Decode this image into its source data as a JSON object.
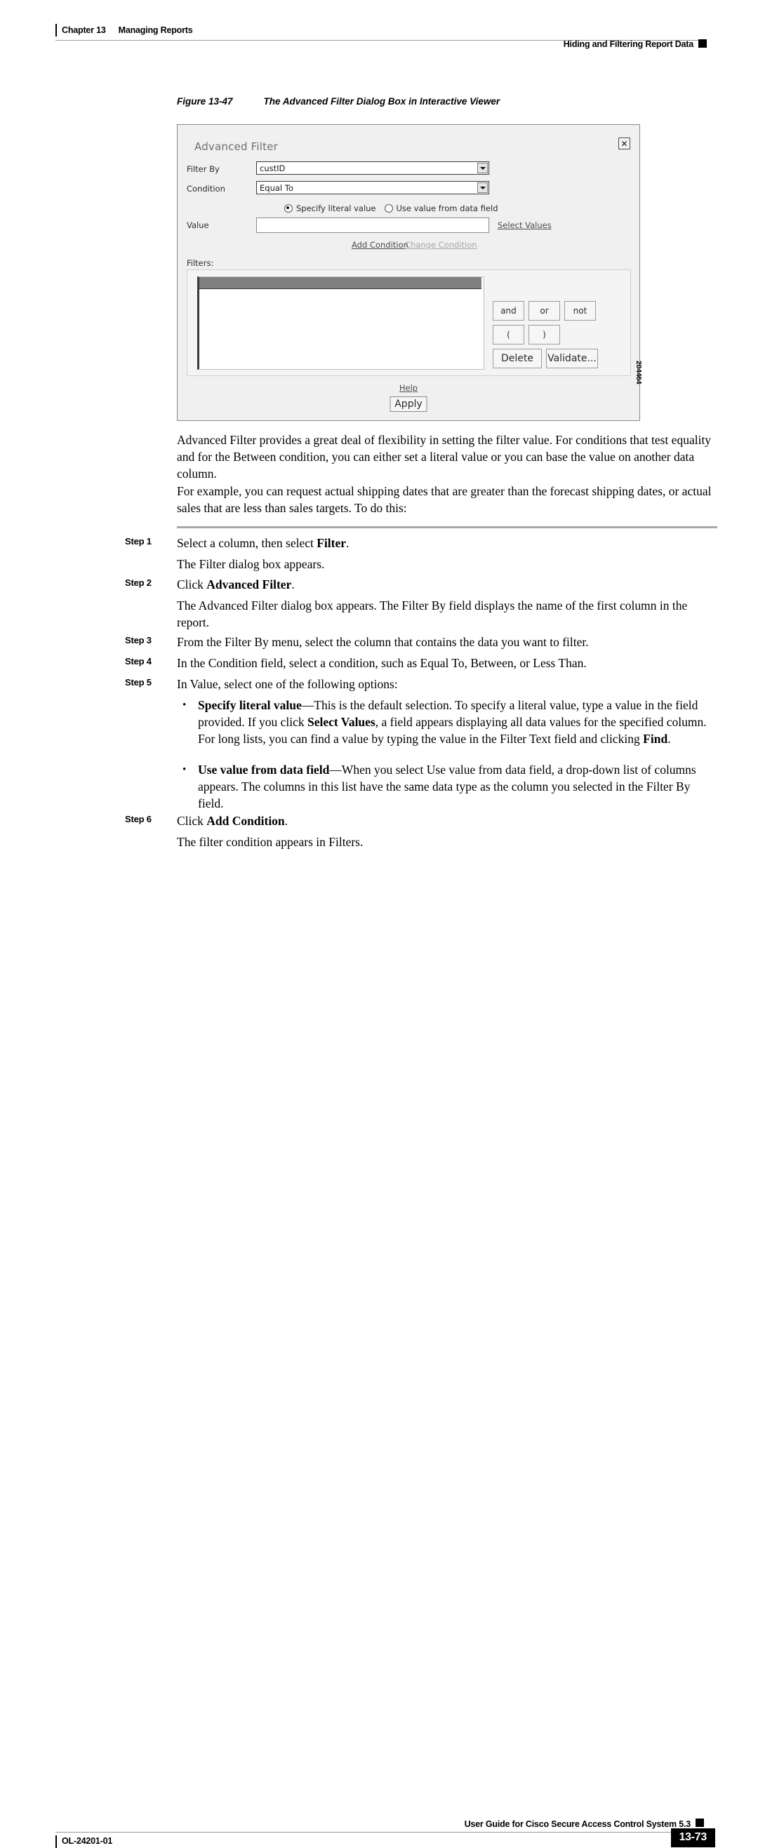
{
  "header": {
    "chapter_no": "Chapter 13",
    "chapter_title": "Managing Reports",
    "section_title": "Hiding and Filtering Report Data"
  },
  "figure": {
    "number": "Figure 13-47",
    "title": "The Advanced Filter Dialog Box in Interactive Viewer",
    "graphic_id": "204464",
    "dialog": {
      "title": "Advanced Filter",
      "close_label": "✕",
      "filter_by_label": "Filter By",
      "filter_by_value": "custID",
      "condition_label": "Condition",
      "condition_value": "Equal To",
      "radio_specify_label": "Specify literal value",
      "radio_datafield_label": "Use value from data field",
      "value_label": "Value",
      "value_input": "",
      "select_values_link": "Select Values",
      "add_condition_link": "Add Condition",
      "change_condition_link": "Change Condition",
      "filters_label": "Filters:",
      "op_and": "and",
      "op_or": "or",
      "op_not": "not",
      "op_open_paren": "(",
      "op_close_paren": ")",
      "op_delete": "Delete",
      "op_validate": "Validate...",
      "help_link": "Help",
      "apply_button": "Apply"
    }
  },
  "body": {
    "para1": "Advanced Filter provides a great deal of flexibility in setting the filter value. For conditions that test equality and for the Between condition, you can either set a literal value or you can base the value on another data column.",
    "para2": "For example, you can request actual shipping dates that are greater than the forecast shipping dates, or actual sales that are less than sales targets. To do this:"
  },
  "steps": [
    {
      "label": "Step 1",
      "text_html": "Select a column, then select <b>Filter</b>."
    },
    {
      "label": "",
      "text_html": "The Filter dialog box appears."
    },
    {
      "label": "Step 2",
      "text_html": "Click <b>Advanced Filter</b>."
    },
    {
      "label": "",
      "text_html": "The Advanced Filter dialog box appears. The Filter By field displays the name of the first column in the report."
    },
    {
      "label": "Step 3",
      "text_html": "From the Filter By menu, select the column that contains the data you want to filter."
    },
    {
      "label": "Step 4",
      "text_html": "In the Condition field, select a condition, such as Equal To, Between, or Less Than."
    },
    {
      "label": "Step 5",
      "text_html": "In Value, select one of the following options:"
    },
    {
      "label": "Step 6",
      "text_html": "Click <b>Add Condition</b>."
    },
    {
      "label": "",
      "text_html": "The filter condition appears in Filters."
    }
  ],
  "bullets": [
    {
      "marker": "•",
      "text_html": "<b>Specify literal value</b>—This is the default selection. To specify a literal value, type a value in the field provided. If you click <b>Select Values</b>, a field appears displaying all data values for the specified column. For long lists, you can find a value by typing the value in the Filter Text field and clicking <b>Find</b>."
    },
    {
      "marker": "•",
      "text_html": "<b>Use value from data field</b>—When you select Use value from data field, a drop-down list of columns appears. The columns in this list have the same data type as the column you selected in the Filter By field."
    }
  ],
  "footer": {
    "guide_title": "User Guide for Cisco Secure Access Control System 5.3",
    "doc_id": "OL-24201-01",
    "page_number": "13-73"
  }
}
